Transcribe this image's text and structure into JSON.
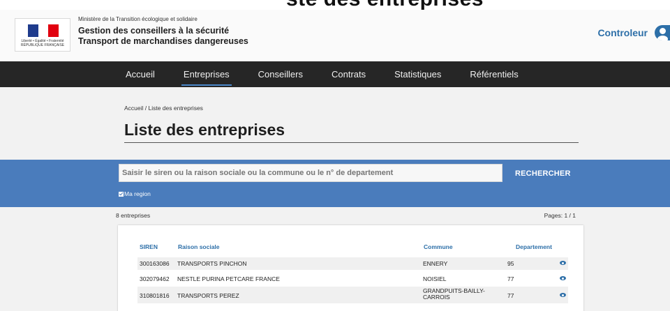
{
  "top_partial_title": "ste des entreprises",
  "header": {
    "logo_caption": "Liberté • Égalité • Fraternité RÉPUBLIQUE FRANÇAISE",
    "ministry": "Ministère de la Transition écologique et solidaire",
    "title_line1": "Gestion des conseillers à la sécurité",
    "title_line2": "Transport de marchandises dangereuses",
    "user_label": "Controleur"
  },
  "nav": {
    "items": [
      {
        "label": "Accueil"
      },
      {
        "label": "Entreprises",
        "active": true
      },
      {
        "label": "Conseillers"
      },
      {
        "label": "Contrats"
      },
      {
        "label": "Statistiques"
      },
      {
        "label": "Référentiels"
      }
    ]
  },
  "breadcrumb": "Accueil / Liste des entreprises",
  "page_title": "Liste des entreprises",
  "search": {
    "placeholder": "Saisir le siren ou la raison sociale ou la commune ou le n° de departement",
    "button_label": "RECHERCHER",
    "region_label": "Ma region",
    "region_checked": true
  },
  "results": {
    "count_label": "8 entreprises",
    "pages_label": "Pages: 1 / 1"
  },
  "table": {
    "columns": [
      "SIREN",
      "Raison sociale",
      "Commune",
      "Departement"
    ],
    "rows": [
      {
        "siren": "300163086",
        "raison": "TRANSPORTS PINCHON",
        "commune": "ENNERY",
        "dept": "95"
      },
      {
        "siren": "302079462",
        "raison": "NESTLE PURINA PETCARE FRANCE",
        "commune": "NOISIEL",
        "dept": "77"
      },
      {
        "siren": "310801816",
        "raison": "TRANSPORTS PEREZ",
        "commune": "GRANDPUITS-BAILLY-CARROIS",
        "dept": "77"
      }
    ]
  },
  "colors": {
    "nav_bg": "#262626",
    "accent": "#2d6fa8",
    "search_band": "#4a7cbc"
  }
}
